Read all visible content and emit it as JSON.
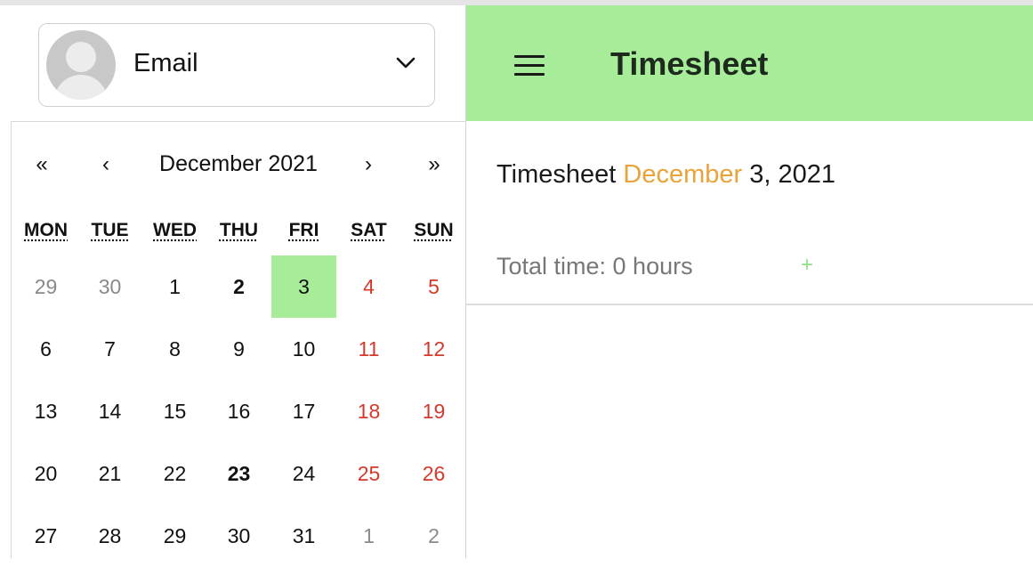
{
  "account": {
    "label": "Email"
  },
  "calendar": {
    "nav": {
      "prev2": "«",
      "prev": "‹",
      "next": "›",
      "next2": "»"
    },
    "month_label": "December 2021",
    "weekdays": [
      "MON",
      "TUE",
      "WED",
      "THU",
      "FRI",
      "SAT",
      "SUN"
    ],
    "weeks": [
      [
        "29",
        "30",
        "1",
        "2",
        "3",
        "4",
        "5"
      ],
      [
        "6",
        "7",
        "8",
        "9",
        "10",
        "11",
        "12"
      ],
      [
        "13",
        "14",
        "15",
        "16",
        "17",
        "18",
        "19"
      ],
      [
        "20",
        "21",
        "22",
        "23",
        "24",
        "25",
        "26"
      ],
      [
        "27",
        "28",
        "29",
        "30",
        "31",
        "1",
        "2"
      ]
    ],
    "selected_day": "3",
    "weekend_color": "#d33a2c",
    "selected_color": "#a7ed99"
  },
  "header": {
    "title": "Timesheet",
    "menu_icon": "hamburger-icon",
    "color": "#a7ed99"
  },
  "content": {
    "title_prefix": "Timesheet",
    "title_month": "December",
    "title_rest": "3, 2021",
    "accent_color": "#e8a33a",
    "total_time": "Total time: 0 hours",
    "add_label": "+"
  }
}
